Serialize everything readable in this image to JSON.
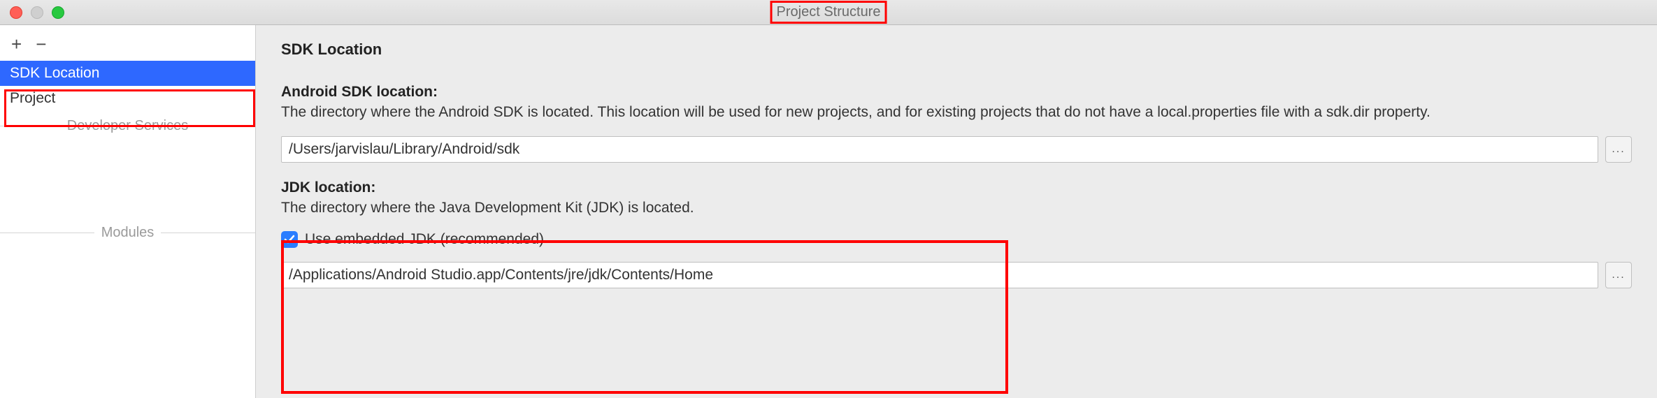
{
  "window": {
    "title": "Project Structure"
  },
  "sidebar": {
    "items": [
      {
        "label": "SDK Location",
        "selected": true
      },
      {
        "label": "Project",
        "selected": false
      }
    ],
    "groups": [
      {
        "label": "Developer Services"
      },
      {
        "label": "Modules"
      }
    ]
  },
  "content": {
    "heading": "SDK Location",
    "sdk": {
      "title": "Android SDK location:",
      "desc": "The directory where the Android SDK is located. This location will be used for new projects, and for existing projects that do not have a local.properties file with a sdk.dir property.",
      "value": "/Users/jarvislau/Library/Android/sdk",
      "browse": "..."
    },
    "jdk": {
      "title": "JDK location:",
      "desc": "The directory where the Java Development Kit (JDK) is located.",
      "checkbox_label": "Use embedded JDK (recommended)",
      "checkbox_checked": true,
      "value": "/Applications/Android Studio.app/Contents/jre/jdk/Contents/Home",
      "browse": "..."
    }
  }
}
